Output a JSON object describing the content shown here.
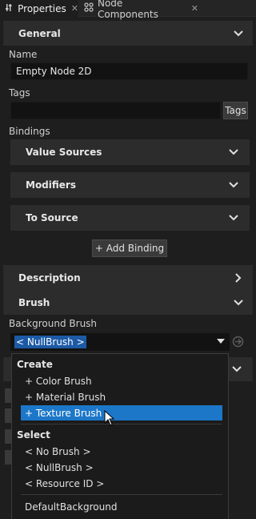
{
  "tabs": [
    {
      "label": "Properties",
      "icon": "sliders-icon",
      "close": "✕"
    },
    {
      "label": "Node Components",
      "icon": "components-icon",
      "close": "✕"
    }
  ],
  "general": {
    "title": "General",
    "name_label": "Name",
    "name_value": "Empty Node 2D",
    "tags_label": "Tags",
    "tags_value": "",
    "tags_button": "Tags",
    "bindings_label": "Bindings",
    "value_sources": "Value Sources",
    "modifiers": "Modifiers",
    "to_source": "To Source",
    "add_binding": "+ Add Binding"
  },
  "description": {
    "title": "Description"
  },
  "brush": {
    "title": "Brush",
    "background_label": "Background Brush",
    "background_value": "< NullBrush >"
  },
  "dropdown": {
    "create_header": "Create",
    "create_items": [
      "+ Color Brush",
      "+ Material Brush",
      "+ Texture Brush"
    ],
    "highlighted_index": 2,
    "select_header": "Select",
    "select_items": [
      "< No Brush >",
      "< NullBrush >",
      "< Resource ID >"
    ],
    "resource_item": "DefaultBackground"
  },
  "colors": {
    "background": "#1e1e1e",
    "section": "#2c2c2c",
    "accent": "#1c77c9",
    "selection": "#1c5aa6"
  }
}
